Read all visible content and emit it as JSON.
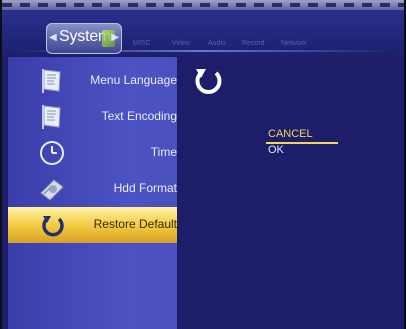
{
  "header": {
    "active_tab": "System",
    "tabs": [
      "MISC",
      "Video",
      "Audio",
      "Record",
      "Network"
    ]
  },
  "sidebar": {
    "items": [
      {
        "label": "Menu Language",
        "icon": "flag-icon",
        "selected": false
      },
      {
        "label": "Text Encoding",
        "icon": "flag-icon",
        "selected": false
      },
      {
        "label": "Time",
        "icon": "clock-icon",
        "selected": false
      },
      {
        "label": "Hdd Format",
        "icon": "hdd-icon",
        "selected": false
      },
      {
        "label": "Restore Default",
        "icon": "restore-icon",
        "selected": true
      }
    ]
  },
  "dialog": {
    "options": [
      "CANCEL",
      "OK"
    ],
    "selected_option": "CANCEL"
  },
  "colors": {
    "background": "#1d1d6a",
    "sidebar": "#454bb8",
    "selection": "#f1c83c",
    "highlight_text": "#f3d55a"
  }
}
